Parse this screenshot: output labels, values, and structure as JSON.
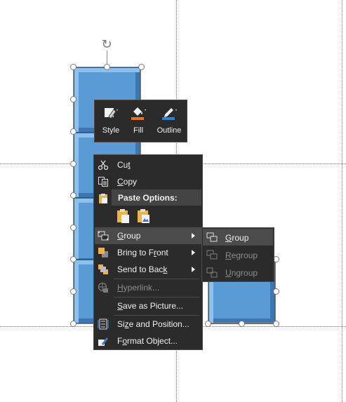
{
  "mini_toolbar": {
    "style_label": "Style",
    "fill_label": "Fill",
    "outline_label": "Outline",
    "fill_color": "#e8711c",
    "outline_color": "#2f7fd1"
  },
  "context_menu": {
    "cut": {
      "pre": "Cu",
      "key": "t",
      "post": ""
    },
    "copy": {
      "pre": "",
      "key": "C",
      "post": "opy"
    },
    "paste_options": "Paste Options:",
    "group": {
      "pre": "",
      "key": "G",
      "post": "roup"
    },
    "bring_to_front": {
      "pre": "Bring to F",
      "key": "r",
      "post": "ont"
    },
    "send_to_back": {
      "pre": "Send to Bac",
      "key": "k",
      "post": ""
    },
    "hyperlink": {
      "pre": "",
      "key": "H",
      "post": "yperlink..."
    },
    "save_as_picture": {
      "pre": "",
      "key": "S",
      "post": "ave as Picture..."
    },
    "size_and_position": {
      "pre": "Si",
      "key": "z",
      "post": "e and Position..."
    },
    "format_object": {
      "pre": "F",
      "key": "o",
      "post": "rmat Object..."
    }
  },
  "group_submenu": {
    "group": {
      "pre": "",
      "key": "G",
      "post": "roup"
    },
    "regroup": {
      "pre": "",
      "key": "R",
      "post": "egroup"
    },
    "ungroup": {
      "pre": "",
      "key": "U",
      "post": "ngroup"
    }
  },
  "colors": {
    "shape_fill": "#5b9bd5",
    "menu_bg": "#2b2b2b",
    "highlight": "#4b4b4b"
  }
}
